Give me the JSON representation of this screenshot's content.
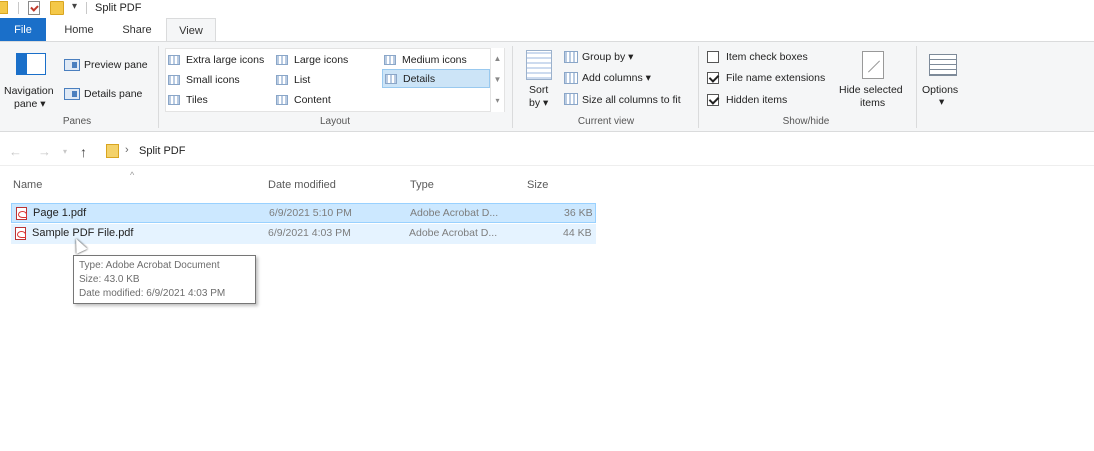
{
  "window": {
    "title": "Split PDF"
  },
  "tabs": [
    {
      "label": "File"
    },
    {
      "label": "Home"
    },
    {
      "label": "Share"
    },
    {
      "label": "View"
    }
  ],
  "ribbon": {
    "panes": {
      "group_label": "Panes",
      "navigation_pane_line1": "Navigation",
      "navigation_pane_line2": "pane",
      "preview_pane": "Preview pane",
      "details_pane": "Details pane"
    },
    "layout": {
      "group_label": "Layout",
      "items": [
        {
          "label": "Extra large icons"
        },
        {
          "label": "Large icons"
        },
        {
          "label": "Medium icons"
        },
        {
          "label": "Small icons"
        },
        {
          "label": "List"
        },
        {
          "label": "Details"
        },
        {
          "label": "Tiles"
        },
        {
          "label": "Content"
        }
      ],
      "selected": "Details"
    },
    "current_view": {
      "group_label": "Current view",
      "sort_by_line1": "Sort",
      "sort_by_line2": "by",
      "group_by": "Group by",
      "add_columns": "Add columns",
      "size_all_columns": "Size all columns to fit"
    },
    "show_hide": {
      "group_label": "Show/hide",
      "item_check_boxes": {
        "label": "Item check boxes",
        "checked": false
      },
      "file_name_extensions": {
        "label": "File name extensions",
        "checked": true
      },
      "hidden_items": {
        "label": "Hidden items",
        "checked": true
      },
      "hide_selected_line1": "Hide selected",
      "hide_selected_line2": "items"
    },
    "options": {
      "label": "Options"
    }
  },
  "address": {
    "path": "Split PDF"
  },
  "columns": {
    "name": "Name",
    "date_modified": "Date modified",
    "type": "Type",
    "size": "Size"
  },
  "files": [
    {
      "name": "Page 1.pdf",
      "date": "6/9/2021 5:10 PM",
      "type": "Adobe Acrobat D...",
      "size": "36 KB",
      "state": "selected"
    },
    {
      "name": "Sample PDF File.pdf",
      "date": "6/9/2021 4:03 PM",
      "type": "Adobe Acrobat D...",
      "size": "44 KB",
      "state": "hover"
    }
  ],
  "tooltip": {
    "type": "Type: Adobe Acrobat Document",
    "size": "Size: 43.0 KB",
    "date": "Date modified: 6/9/2021 4:03 PM"
  },
  "colors": {
    "file_tab": "#1a6fc9",
    "selection": "#cce8ff",
    "hover": "#e5f3ff"
  }
}
